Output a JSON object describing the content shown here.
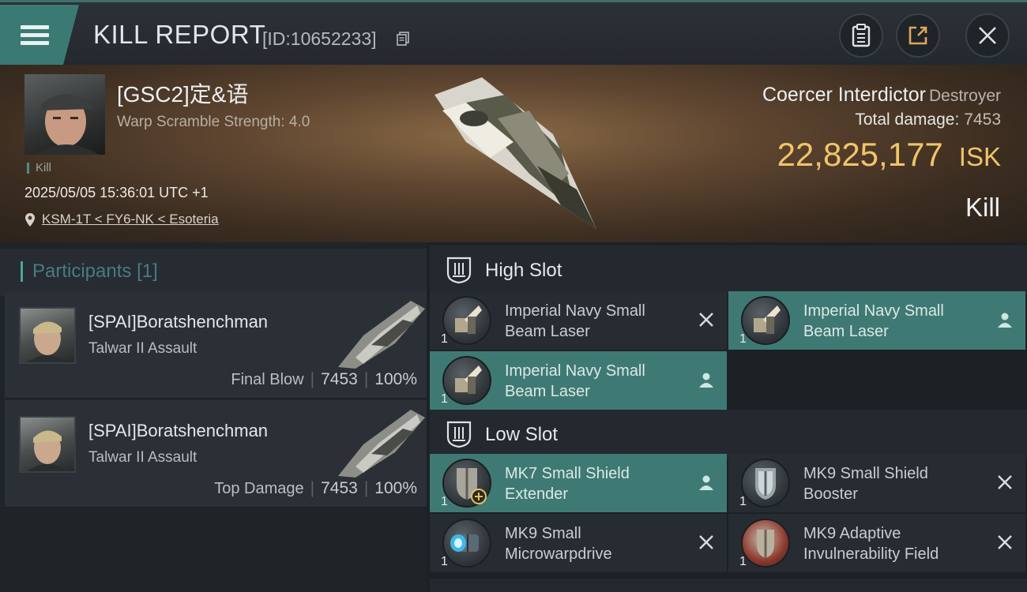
{
  "header": {
    "title": "KILL REPORT",
    "report_id": "[ID:10652233]"
  },
  "victim": {
    "name": "[GSC2]定&语",
    "warp_scramble": "Warp Scramble Strength: 4.0",
    "tag": "Kill",
    "datetime": "2025/05/05 15:36:01 UTC +1",
    "location": "KSM-1T < FY6-NK < Esoteria",
    "ship": "Coercer Interdictor",
    "ship_class": "Destroyer",
    "total_damage_label": "Total damage:",
    "total_damage": "7453",
    "isk_value": "22,825,177",
    "isk_unit": "ISK",
    "result": "Kill"
  },
  "participants": {
    "label": "Participants",
    "count": "[1]",
    "items": [
      {
        "name": "[SPAI]Boratshenchman",
        "ship": "Talwar II Assault",
        "role": "Final Blow",
        "damage": "7453",
        "percent": "100%"
      },
      {
        "name": "[SPAI]Boratshenchman",
        "ship": "Talwar II Assault",
        "role": "Top Damage",
        "damage": "7453",
        "percent": "100%"
      }
    ]
  },
  "fitting": {
    "high_slot_label": "High Slot",
    "low_slot_label": "Low Slot",
    "high": [
      {
        "line1": "Imperial Navy Small",
        "line2": "Beam Laser",
        "qty": "1",
        "status": "destroyed"
      },
      {
        "line1": "Imperial Navy Small",
        "line2": "Beam Laser",
        "qty": "1",
        "status": "dropped"
      },
      {
        "line1": "Imperial Navy Small",
        "line2": "Beam Laser",
        "qty": "1",
        "status": "dropped"
      }
    ],
    "low": [
      {
        "line1": "MK7 Small Shield",
        "line2": "Extender",
        "qty": "1",
        "status": "dropped"
      },
      {
        "line1": "MK9 Small Shield",
        "line2": "Booster",
        "qty": "1",
        "status": "destroyed"
      },
      {
        "line1": "MK9 Small",
        "line2": "Microwarpdrive",
        "qty": "1",
        "status": "destroyed"
      },
      {
        "line1": "MK9 Adaptive",
        "line2": "Invulnerability Field",
        "qty": "1",
        "status": "destroyed"
      }
    ]
  },
  "colors": {
    "accent": "#3e7a73",
    "isk": "#f0c46a",
    "panel": "#262c31"
  },
  "icons": [
    "menu-icon",
    "copy-icon",
    "clipboard-icon",
    "share-icon",
    "close-icon",
    "location-pin-icon",
    "slot-shield-icon",
    "destroyed-x-icon",
    "person-icon"
  ]
}
